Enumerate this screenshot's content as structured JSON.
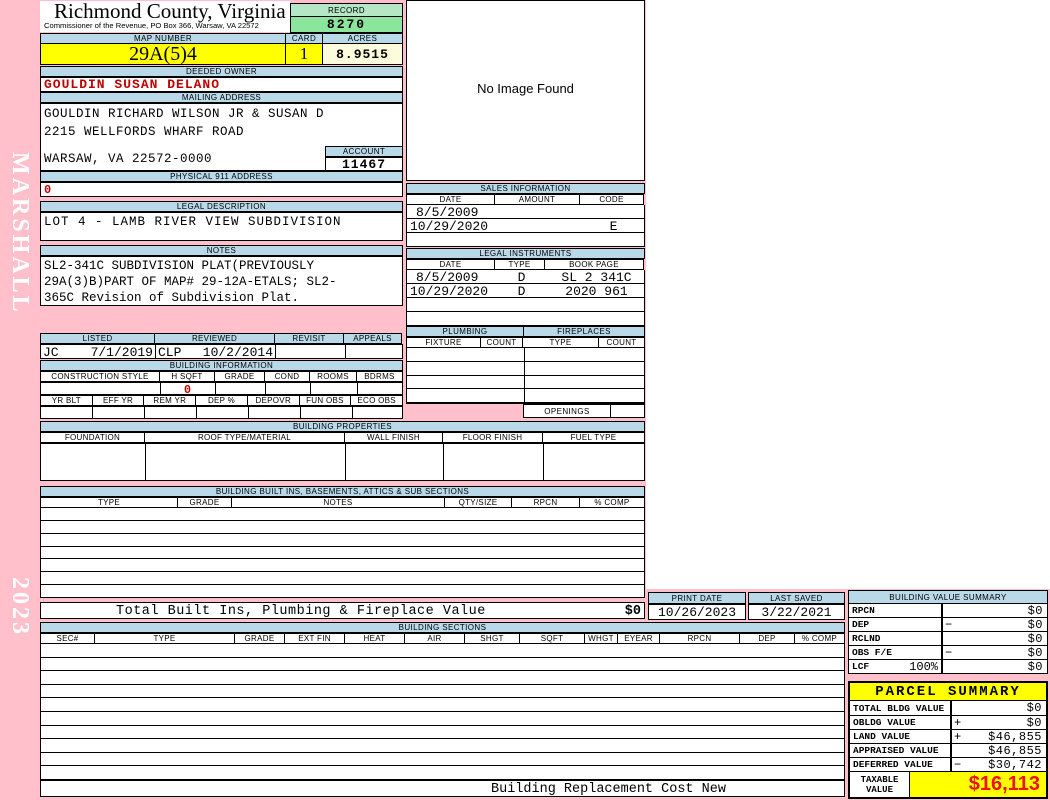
{
  "page": {
    "watermark": "MARSHALL",
    "year": "2023"
  },
  "header": {
    "county": "Richmond County, Virginia",
    "commissioner": "Commissioner of the Revenue, PO Box 366, Warsaw, VA 22572",
    "record_label": "RECORD",
    "record_value": "8270",
    "map_label": "MAP NUMBER",
    "map_value": "29A(5)4",
    "card_label": "CARD",
    "card_value": "1",
    "acres_label": "ACRES",
    "acres_value": "8.9515"
  },
  "owner": {
    "label": "DEEDED OWNER",
    "name": "GOULDIN SUSAN DELANO"
  },
  "mailing": {
    "label": "MAILING ADDRESS",
    "line1": "GOULDIN RICHARD WILSON JR & SUSAN D",
    "line2": "2215 WELLFORDS WHARF ROAD",
    "line3": "WARSAW, VA 22572-0000",
    "account_label": "ACCOUNT",
    "account_value": "11467"
  },
  "physical911": {
    "label": "PHYSICAL 911 ADDRESS",
    "value": "0"
  },
  "legal_description": {
    "label": "LEGAL DESCRIPTION",
    "value": "LOT 4 - LAMB RIVER VIEW SUBDIVISION"
  },
  "notes": {
    "label": "NOTES",
    "line1": "SL2-341C SUBDIVISION PLAT(PREVIOUSLY",
    "line2": "29A(3)B)PART OF MAP# 29-12A-ETALS; SL2-",
    "line3": "365C Revision of Subdivision Plat."
  },
  "image_panel": {
    "message": "No Image Found"
  },
  "sales": {
    "title": "SALES INFORMATION",
    "col_date": "DATE",
    "col_amount": "AMOUNT",
    "col_code": "CODE",
    "rows": [
      {
        "date": "8/5/2009",
        "amount": "",
        "code": ""
      },
      {
        "date": "10/29/2020",
        "amount": "",
        "code": "E"
      }
    ]
  },
  "instruments": {
    "title": "LEGAL INSTRUMENTS",
    "col_date": "DATE",
    "col_type": "TYPE",
    "col_bookpage": "BOOK PAGE",
    "rows": [
      {
        "date": "8/5/2009",
        "type": "D",
        "bookpage": "SL 2 341C"
      },
      {
        "date": "10/29/2020",
        "type": "D",
        "bookpage": "2020 961"
      }
    ]
  },
  "plumbing": {
    "title": "PLUMBING",
    "col_fixture": "FIXTURE",
    "col_count": "COUNT"
  },
  "fireplaces": {
    "title": "FIREPLACES",
    "col_type": "TYPE",
    "col_count": "COUNT",
    "openings_label": "OPENINGS"
  },
  "review": {
    "col_listed": "LISTED",
    "col_reviewed": "REVIEWED",
    "col_revisit": "REVISIT",
    "col_appeals": "APPEALS",
    "listed_by": "JC",
    "listed_date": "7/1/2019",
    "reviewed_by": "CLP",
    "reviewed_date": "10/2/2014"
  },
  "building_info": {
    "title": "BUILDING INFORMATION",
    "cols1": [
      "CONSTRUCTION STYLE",
      "H SQFT",
      "GRADE",
      "COND",
      "ROOMS",
      "BDRMS"
    ],
    "hsqft_value": "0",
    "cols2": [
      "YR BLT",
      "EFF YR",
      "REM YR",
      "DEP %",
      "DEPOVR",
      "FUN OBS",
      "ECO OBS"
    ]
  },
  "building_properties": {
    "title": "BUILDING PROPERTIES",
    "cols": [
      "FOUNDATION",
      "ROOF TYPE/MATERIAL",
      "WALL FINISH",
      "FLOOR FINISH",
      "FUEL TYPE"
    ]
  },
  "built_ins": {
    "title": "BUILDING BUILT INS, BASEMENTS, ATTICS & SUB SECTIONS",
    "cols": [
      "TYPE",
      "GRADE",
      "NOTES",
      "QTY/SIZE",
      "RPCN",
      "% COMP"
    ],
    "total_label": "Total Built Ins, Plumbing & Fireplace Value",
    "total_value": "$0"
  },
  "dates": {
    "print_label": "PRINT DATE",
    "print_value": "10/26/2023",
    "saved_label": "LAST SAVED",
    "saved_value": "3/22/2021"
  },
  "building_sections": {
    "title": "BUILDING SECTIONS",
    "cols": [
      "SEC#",
      "TYPE",
      "GRADE",
      "EXT FIN",
      "HEAT",
      "AIR",
      "SHGT",
      "SQFT",
      "WHGT",
      "EYEAR",
      "RPCN",
      "DEP",
      "% COMP"
    ],
    "footer": "Building Replacement Cost New"
  },
  "value_summary": {
    "title": "BUILDING VALUE SUMMARY",
    "rows": [
      {
        "label": "RPCN",
        "op": "",
        "value": "$0"
      },
      {
        "label": "DEP",
        "op": "−",
        "value": "$0"
      },
      {
        "label": "RCLND",
        "op": "",
        "value": "$0"
      },
      {
        "label": "OBS F/E",
        "op": "−",
        "value": "$0"
      },
      {
        "label": "LCF",
        "pct": "100%",
        "op": "",
        "value": "$0"
      }
    ]
  },
  "parcel_summary": {
    "title": "PARCEL SUMMARY",
    "rows": [
      {
        "label": "TOTAL BLDG VALUE",
        "op": "",
        "value": "$0"
      },
      {
        "label": "OBLDG VALUE",
        "op": "+",
        "value": "$0"
      },
      {
        "label": "LAND VALUE",
        "op": "+",
        "value": "$46,855"
      },
      {
        "label": "APPRAISED VALUE",
        "op": "",
        "value": "$46,855"
      },
      {
        "label": "DEFERRED VALUE",
        "op": "−",
        "value": "$30,742"
      }
    ],
    "taxable_label_1": "TAXABLE",
    "taxable_label_2": "VALUE",
    "taxable_value": "$16,113"
  },
  "colors": {
    "header_bar": "#B9D9E8",
    "record_green": "#8CE59C",
    "record_header_green": "#B5E6C6",
    "highlight_yellow": "#FFFF00",
    "acres_cream": "#FCFCDC",
    "page_pink": "#FFC0CB",
    "alert_red": "#C00000",
    "taxable_red": "#EE1111"
  }
}
